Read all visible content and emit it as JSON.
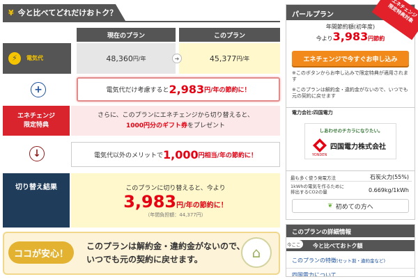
{
  "header": {
    "title": "今と比べてどれだけおトク？",
    "yen_icon": "yen-icon"
  },
  "columns": {
    "current": "現在のプラン",
    "new": "このプラン"
  },
  "electricity": {
    "label": "電気代",
    "current_value": "48,360",
    "current_unit": "円/年",
    "new_value": "45,377",
    "new_unit": "円/年"
  },
  "savings": {
    "prefix": "電気代だけ考慮すると",
    "amount": "2,983",
    "suffix": "円/年の節約に！"
  },
  "enechange": {
    "label_line1": "エネチェンジ",
    "label_line2": "限定特典",
    "line1": "さらに、このプランにエネチェンジから切り替えると、",
    "gift_amount": "1000円分のギフト券",
    "line2_suffix": "をプレゼント"
  },
  "other_merit": {
    "prefix": "電気代以外のメリットで",
    "amount": "1,000",
    "suffix": "円相当/年の節約に！"
  },
  "switch_result": {
    "label": "切り替え結果",
    "line1": "このプランに切り替えると、今より",
    "amount": "3,983",
    "suffix": "円/年の節約に！",
    "burden": "（年間負担額：44,377円）"
  },
  "safe": {
    "tag": "ココが安心！",
    "line1": "このプランは解約金・違約金がないので、",
    "line2": "いつでも元の契約に戻せます。"
  },
  "right_panel": {
    "title": "パールプラン",
    "ribbon_line1": "エネチェンジ",
    "ribbon_line2": "限定特典対象",
    "subtitle": "年間節約額(初年度)",
    "price_prefix": "今より",
    "price_amount": "3,983",
    "price_suffix": "円節約",
    "button": "エネチェンジで今すぐお申し込み",
    "note1": "※このボタンからお申し込みで限定特典が適用されます",
    "note2": "※このプランは解約金・違約金がないので、いつでも元の契約に戻せます",
    "company_label": "電力会社:四国電力",
    "logo_slogan": "しあわせのチカラになりたい。",
    "logo_name": "四国電力株式会社",
    "logo_sub": "YONDEN",
    "source_label": "最も多く使う発電方法",
    "source_value": "石炭火力(55%)",
    "co2_label_1": "1kWhの電気を作るために",
    "co2_label_2": "排出するCO2の量",
    "co2_value": "0.669kg/1kWh",
    "guide": "初めての方へ"
  },
  "detail_panel": {
    "title": "このプランの詳細情報",
    "badge": "今ここ",
    "tab": "今と比べておトク額",
    "link1": "このプランの特徴",
    "link1_sub": "(セット割・違約金など)",
    "link2": "四国電力について"
  }
}
